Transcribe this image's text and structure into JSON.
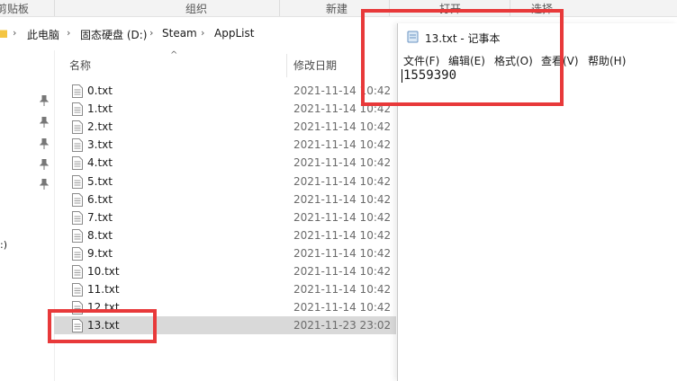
{
  "ribbon": {
    "groups": [
      "剪贴板",
      "组织",
      "新建",
      "打开",
      "选择"
    ]
  },
  "address": {
    "crumbs": [
      "此电脑",
      "固态硬盘 (D:)",
      "Steam",
      "AppList"
    ]
  },
  "columns": {
    "name": "名称",
    "modified": "修改日期"
  },
  "nav": {
    "drive_fragment": ":)"
  },
  "files": [
    {
      "name": "0.txt",
      "date": "2021-11-14 10:42"
    },
    {
      "name": "1.txt",
      "date": "2021-11-14 10:42"
    },
    {
      "name": "2.txt",
      "date": "2021-11-14 10:42"
    },
    {
      "name": "3.txt",
      "date": "2021-11-14 10:42"
    },
    {
      "name": "4.txt",
      "date": "2021-11-14 10:42"
    },
    {
      "name": "5.txt",
      "date": "2021-11-14 10:42"
    },
    {
      "name": "6.txt",
      "date": "2021-11-14 10:42"
    },
    {
      "name": "7.txt",
      "date": "2021-11-14 10:42"
    },
    {
      "name": "8.txt",
      "date": "2021-11-14 10:42"
    },
    {
      "name": "9.txt",
      "date": "2021-11-14 10:42"
    },
    {
      "name": "10.txt",
      "date": "2021-11-14 10:42"
    },
    {
      "name": "11.txt",
      "date": "2021-11-14 10:42"
    },
    {
      "name": "12.txt",
      "date": "2021-11-14 10:42"
    },
    {
      "name": "13.txt",
      "date": "2021-11-23 23:02",
      "selected": true
    }
  ],
  "notepad": {
    "title": "13.txt - 记事本",
    "menu": [
      "文件(F)",
      "编辑(E)",
      "格式(O)",
      "查看(V)",
      "帮助(H)"
    ],
    "content": "1559390"
  },
  "colors": {
    "annotation": "#e8393a",
    "selected_row": "#d9d9d9"
  }
}
